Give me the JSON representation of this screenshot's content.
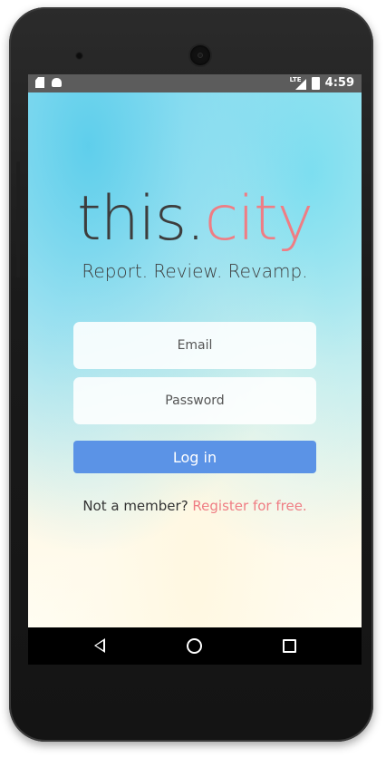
{
  "status_bar": {
    "network_label": "LTE",
    "time": "4:59",
    "icons": [
      "sd-card-icon",
      "android-icon",
      "signal-icon",
      "battery-icon"
    ]
  },
  "app": {
    "brand_part1": "this.",
    "brand_part2": "city",
    "tagline": "Report. Review. Revamp.",
    "email_placeholder": "Email",
    "password_placeholder": "Password",
    "login_label": "Log in",
    "register_prompt": "Not a member? ",
    "register_link": "Register for free.",
    "colors": {
      "accent": "#ef7d84",
      "button": "#5b93e6",
      "text": "#3d3d3d"
    }
  },
  "nav_bar": {
    "icons": [
      "back-icon",
      "home-icon",
      "recent-apps-icon"
    ]
  }
}
